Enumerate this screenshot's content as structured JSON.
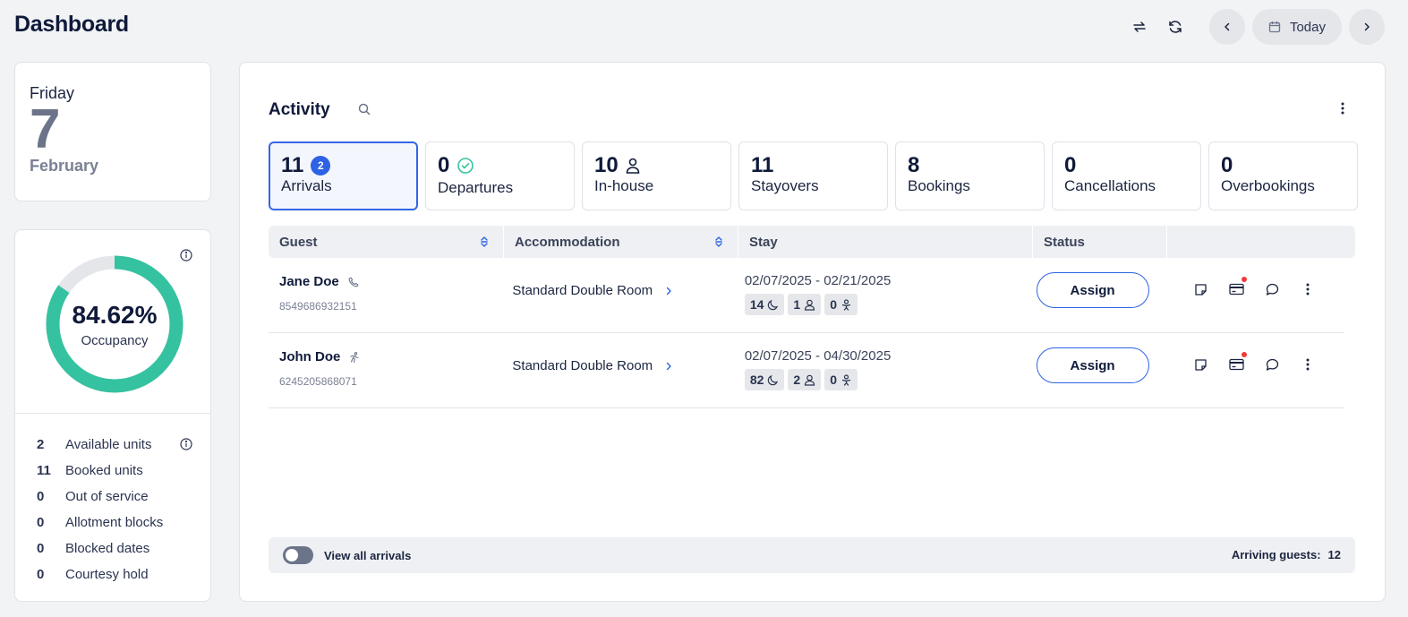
{
  "header": {
    "title": "Dashboard",
    "today_label": "Today"
  },
  "date_card": {
    "weekday": "Friday",
    "day": "7",
    "month": "February"
  },
  "occupancy": {
    "percent_label": "84.62%",
    "percent_value": 84.62,
    "label": "Occupancy",
    "colors": {
      "filled": "#35c2a0",
      "empty": "#e4e6ea"
    },
    "stats": [
      {
        "count": "2",
        "name": "Available units"
      },
      {
        "count": "11",
        "name": "Booked units"
      },
      {
        "count": "0",
        "name": "Out of service"
      },
      {
        "count": "0",
        "name": "Allotment blocks"
      },
      {
        "count": "0",
        "name": "Blocked dates"
      },
      {
        "count": "0",
        "name": "Courtesy hold"
      }
    ]
  },
  "activity": {
    "title": "Activity",
    "tabs": [
      {
        "count": "11",
        "badge": "2",
        "label": "Arrivals",
        "icon": "badge"
      },
      {
        "count": "0",
        "label": "Departures",
        "icon": "check-circle-icon"
      },
      {
        "count": "10",
        "label": "In-house",
        "icon": "person-icon"
      },
      {
        "count": "11",
        "label": "Stayovers"
      },
      {
        "count": "8",
        "label": "Bookings"
      },
      {
        "count": "0",
        "label": "Cancellations"
      },
      {
        "count": "0",
        "label": "Overbookings"
      }
    ],
    "columns": [
      "Guest",
      "Accommodation",
      "Stay",
      "Status"
    ],
    "rows": [
      {
        "guest": "Jane Doe",
        "guest_icon": "phone-icon",
        "id": "8549686932151",
        "accommodation": "Standard Double Room",
        "dates": "02/07/2025 - 02/21/2025",
        "nights": "14",
        "adults": "1",
        "children": "0",
        "status_button": "Assign"
      },
      {
        "guest": "John Doe",
        "guest_icon": "walk-in-icon",
        "id": "6245205868071",
        "accommodation": "Standard Double Room",
        "dates": "02/07/2025 - 04/30/2025",
        "nights": "82",
        "adults": "2",
        "children": "0",
        "status_button": "Assign"
      }
    ],
    "footer": {
      "toggle_label": "View all arrivals",
      "arriving_label": "Arriving guests:",
      "arriving_count": "12"
    }
  }
}
